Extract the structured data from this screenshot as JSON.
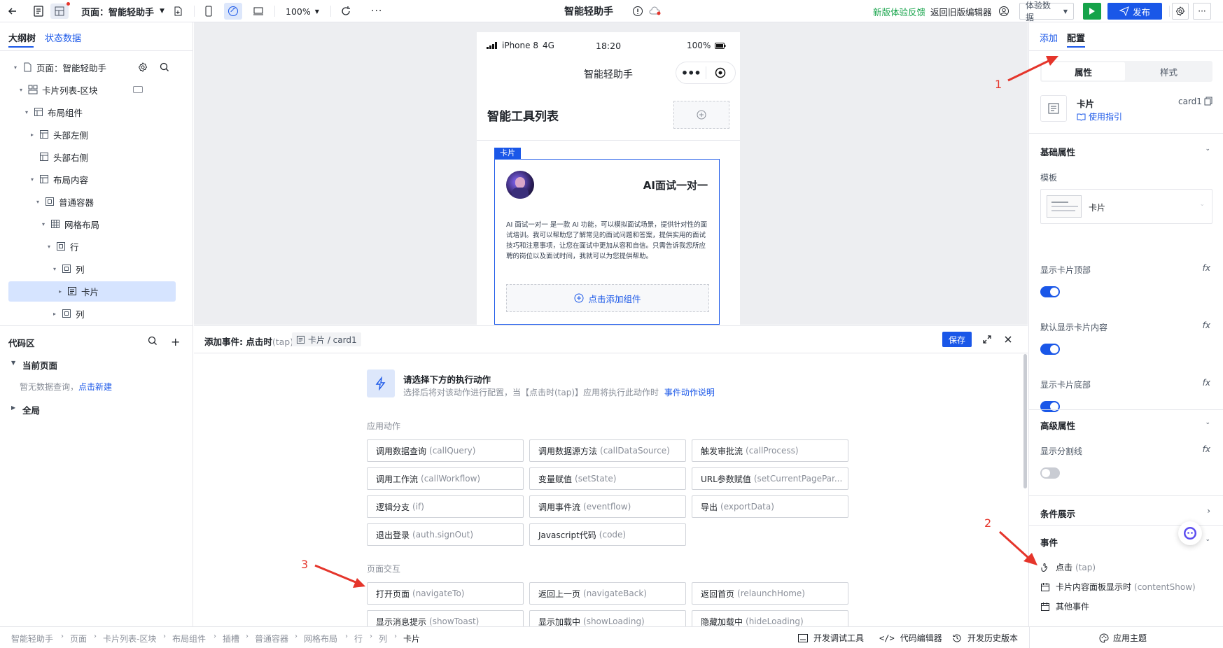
{
  "topbar": {
    "page_select": "页面：智能轻助手",
    "zoom": "100%",
    "app_title": "智能轻助手",
    "feedback_link": "新版体验反馈",
    "legacy_link": "返回旧版编辑器",
    "data_select": "体验数据",
    "publish_label": "发布"
  },
  "left": {
    "tabs": [
      "大纲树",
      "状态数据"
    ],
    "tree": [
      {
        "label": "页面：智能轻助手",
        "depth": 0,
        "caret": "down",
        "icon": "page-icon"
      },
      {
        "label": "卡片列表-区块",
        "depth": 1,
        "caret": "down",
        "icon": "block-icon"
      },
      {
        "label": "布局组件",
        "depth": 2,
        "caret": "down",
        "icon": "layout-icon"
      },
      {
        "label": "头部左侧",
        "depth": 3,
        "caret": "right",
        "icon": "layout-icon"
      },
      {
        "label": "头部右侧",
        "depth": 3,
        "caret": "",
        "icon": "layout-icon"
      },
      {
        "label": "布局内容",
        "depth": 3,
        "caret": "down",
        "icon": "layout-icon"
      },
      {
        "label": "普通容器",
        "depth": 4,
        "caret": "down",
        "icon": "container-icon"
      },
      {
        "label": "网格布局",
        "depth": 5,
        "caret": "down",
        "icon": "grid-icon"
      },
      {
        "label": "行",
        "depth": 6,
        "caret": "down",
        "icon": "container-icon"
      },
      {
        "label": "列",
        "depth": 7,
        "caret": "down",
        "icon": "container-icon"
      },
      {
        "label": "卡片",
        "depth": 8,
        "caret": "right",
        "icon": "card-icon",
        "selected": true
      },
      {
        "label": "列",
        "depth": 7,
        "caret": "right",
        "icon": "container-icon"
      }
    ],
    "code_title": "代码区",
    "current_page": "当前页面",
    "empty_text": "暂无数据查询，",
    "new_link": "点击新建",
    "global": "全局"
  },
  "phone": {
    "carrier": "iPhone 8",
    "network": "4G",
    "time": "18:20",
    "battery": "100%",
    "nav_title": "智能轻助手",
    "list_title": "智能工具列表",
    "card_tag": "卡片",
    "card_title": "AI面试一对一",
    "card_desc": "AI 面试一对一 是一款 AI 功能，可以模拟面试场景，提供针对性的面试培训。我可以帮助您了解常见的面试问题和答案，提供实用的面试技巧和注意事项，让您在面试中更加从容和自信。只需告诉我您所应聘的岗位以及面试时间，我就可以为您提供帮助。",
    "add_component": "点击添加组件"
  },
  "event": {
    "title_prefix": "添加事件: 点击时",
    "title_suffix": "(tap)",
    "target": "卡片 / card1",
    "save_label": "保存",
    "prompt_title": "请选择下方的执行动作",
    "prompt_desc": "选择后将对该动作进行配置，当【点击时(tap)】应用将执行此动作时",
    "help_link": "事件动作说明",
    "app_actions_label": "应用动作",
    "app_actions": [
      {
        "cn": "调用数据查询",
        "en": "(callQuery)"
      },
      {
        "cn": "调用数据源方法",
        "en": "(callDataSource)"
      },
      {
        "cn": "触发审批流",
        "en": "(callProcess)"
      },
      {
        "cn": "调用工作流",
        "en": "(callWorkflow)"
      },
      {
        "cn": "变量赋值",
        "en": "(setState)"
      },
      {
        "cn": "URL参数赋值",
        "en": "(setCurrentPagePar..."
      },
      {
        "cn": "逻辑分支",
        "en": "(if)"
      },
      {
        "cn": "调用事件流",
        "en": "(eventflow)"
      },
      {
        "cn": "导出",
        "en": "(exportData)"
      },
      {
        "cn": "退出登录",
        "en": "(auth.signOut)"
      },
      {
        "cn": "Javascript代码",
        "en": "(code)"
      }
    ],
    "page_actions_label": "页面交互",
    "page_actions": [
      {
        "cn": "打开页面",
        "en": "(navigateTo)"
      },
      {
        "cn": "返回上一页",
        "en": "(navigateBack)"
      },
      {
        "cn": "返回首页",
        "en": "(relaunchHome)"
      },
      {
        "cn": "显示消息提示",
        "en": "(showToast)"
      },
      {
        "cn": "显示加载中",
        "en": "(showLoading)"
      },
      {
        "cn": "隐藏加载中",
        "en": "(hideLoading)"
      }
    ]
  },
  "right": {
    "tabs": [
      "添加",
      "配置"
    ],
    "subtabs": [
      "属性",
      "样式"
    ],
    "comp_name": "卡片",
    "comp_id": "card1",
    "guide_link": "使用指引",
    "basic_section": "基础属性",
    "template_label": "模板",
    "template_value": "卡片",
    "props": [
      {
        "label": "显示卡片顶部",
        "on": true
      },
      {
        "label": "默认显示卡片内容",
        "on": true
      },
      {
        "label": "显示卡片底部",
        "on": true
      }
    ],
    "advanced_section": "高级属性",
    "divider_label": "显示分割线",
    "divider_on": false,
    "condition_section": "条件展示",
    "events_section": "事件",
    "events": [
      {
        "cn": "点击",
        "en": "(tap)"
      },
      {
        "cn": "卡片内容面板显示时",
        "en": "(contentShow)"
      },
      {
        "cn": "其他事件",
        "en": ""
      }
    ],
    "fx": "fx"
  },
  "bottom": {
    "breadcrumb": [
      "智能轻助手",
      "页面",
      "卡片列表-区块",
      "布局组件",
      "插槽",
      "普通容器",
      "网格布局",
      "行",
      "列",
      "卡片"
    ],
    "debug_tool": "开发调试工具",
    "code_editor": "代码编辑器",
    "history": "开发历史版本",
    "theme": "应用主题"
  },
  "annotations": [
    "1",
    "2",
    "3"
  ],
  "colors": {
    "primary": "#1a57e8",
    "accent_green": "#16a34a",
    "annot_red": "#e5352b",
    "selected_bg": "#d6e4ff"
  }
}
